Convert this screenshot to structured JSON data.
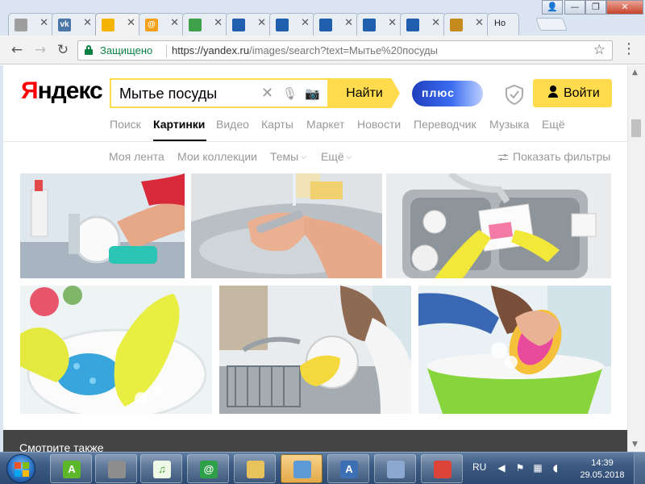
{
  "browser": {
    "tabs": [
      {
        "icon": "blank-page-icon",
        "color": "#9e9e9e",
        "glyph": ""
      },
      {
        "icon": "vk-icon",
        "color": "#4a76a8",
        "glyph": "vk"
      },
      {
        "icon": "yandex-images-icon",
        "color": "#f5b400",
        "glyph": ""
      },
      {
        "icon": "mail-at-icon",
        "color": "#f4a21c",
        "glyph": "@"
      },
      {
        "icon": "green-square-icon",
        "color": "#3fa14a",
        "glyph": ""
      },
      {
        "icon": "window-page-icon",
        "color": "#1f5fae",
        "glyph": ""
      },
      {
        "icon": "window-page-icon",
        "color": "#1f5fae",
        "glyph": ""
      },
      {
        "icon": "window-page-icon",
        "color": "#1f5fae",
        "glyph": ""
      },
      {
        "icon": "window-page-icon",
        "color": "#1f5fae",
        "glyph": ""
      },
      {
        "icon": "window-page-icon",
        "color": "#1f5fae",
        "glyph": ""
      },
      {
        "icon": "news-icon",
        "color": "#c58a1e",
        "glyph": ""
      }
    ],
    "last_tab_title": "Ho",
    "close_glyph": "✕",
    "window_buttons": {
      "user": "👤",
      "minimize": "—",
      "maximize": "❐",
      "close": "✕"
    },
    "security_label": "Защищено",
    "url_host": "https://yandex.ru",
    "url_path": "/images/search?text=Мытье%20посуды",
    "back_glyph": "←",
    "forward_glyph": "→",
    "reload_glyph": "↻",
    "star_glyph": "☆",
    "menu_glyph": "⋮"
  },
  "page": {
    "logo_first": "Я",
    "logo_rest": "ндекс",
    "search": {
      "value": "Мытье посуды",
      "clear_glyph": "✕",
      "mic_glyph": "🎙",
      "camera_glyph": "📷",
      "button": "Найти"
    },
    "plus_label": "плюс",
    "login_label": "Войти",
    "services": [
      {
        "label": "Поиск",
        "active": false
      },
      {
        "label": "Картинки",
        "active": true
      },
      {
        "label": "Видео",
        "active": false
      },
      {
        "label": "Карты",
        "active": false
      },
      {
        "label": "Маркет",
        "active": false
      },
      {
        "label": "Новости",
        "active": false
      },
      {
        "label": "Переводчик",
        "active": false
      },
      {
        "label": "Музыка",
        "active": false
      },
      {
        "label": "Ещё",
        "active": false
      }
    ],
    "subnav": {
      "feed": "Моя лента",
      "collections": "Мои коллекции",
      "themes": "Темы",
      "more": "Ещё",
      "chevron": "⌵"
    },
    "filters_label": "Показать фильтры",
    "results": [
      {
        "alt": "dishwashing-photo-1"
      },
      {
        "alt": "dishwashing-photo-2"
      },
      {
        "alt": "dishwashing-photo-3"
      },
      {
        "alt": "dishwashing-photo-4"
      },
      {
        "alt": "dishwashing-photo-5"
      },
      {
        "alt": "dishwashing-photo-6"
      }
    ],
    "bottom_text": "Смотрите также"
  },
  "taskbar": {
    "items": [
      {
        "icon": "android-app-icon",
        "color": "#5cb82a",
        "glyph": "A"
      },
      {
        "icon": "news-app-icon",
        "color": "#8d8d8d",
        "glyph": ""
      },
      {
        "icon": "music-app-icon",
        "color": "#eef8e6",
        "glyph": "♫"
      },
      {
        "icon": "mail-agent-icon",
        "color": "#2fa04a",
        "glyph": "@"
      },
      {
        "icon": "file-explorer-icon",
        "color": "#e8c25a",
        "glyph": ""
      },
      {
        "icon": "notepad-app-icon",
        "color": "#5e9ad6",
        "glyph": ""
      },
      {
        "icon": "wordpad-app-icon",
        "color": "#3d6fb4",
        "glyph": "A"
      },
      {
        "icon": "paint-app-icon",
        "color": "#8aa8d0",
        "glyph": ""
      },
      {
        "icon": "chrome-app-icon",
        "color": "#db4437",
        "glyph": ""
      }
    ],
    "language": "RU",
    "time": "14:39",
    "date": "29.05.2018"
  }
}
